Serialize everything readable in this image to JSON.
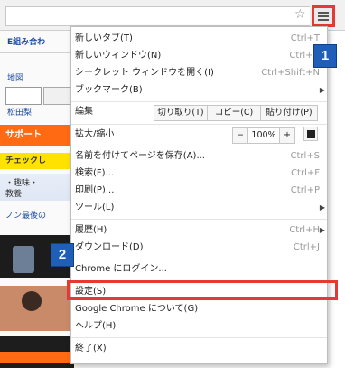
{
  "menu": {
    "items": [
      {
        "label": "新しいタブ(T)",
        "shortcut": "Ctrl+T"
      },
      {
        "label": "新しいウィンドウ(N)",
        "shortcut": "Ctrl+N"
      },
      {
        "label": "シークレット ウィンドウを開く(I)",
        "shortcut": "Ctrl+Shift+N"
      },
      {
        "label": "ブックマーク(B)"
      }
    ],
    "edit": {
      "label": "編集",
      "cut": "切り取り(T)",
      "copy": "コピー(C)",
      "paste": "貼り付け(P)"
    },
    "zoom": {
      "label": "拡大/縮小",
      "minus": "−",
      "value": "100%",
      "plus": "+"
    },
    "items2": [
      {
        "label": "名前を付けてページを保存(A)...",
        "shortcut": "Ctrl+S"
      },
      {
        "label": "検索(F)...",
        "shortcut": "Ctrl+F"
      },
      {
        "label": "印刷(P)...",
        "shortcut": "Ctrl+P"
      },
      {
        "label": "ツール(L)"
      }
    ],
    "history": {
      "label": "履歴(H)",
      "shortcut": "Ctrl+H"
    },
    "downloads": {
      "label": "ダウンロード(D)",
      "shortcut": "Ctrl+J"
    },
    "signin": {
      "label": "Chrome にログイン..."
    },
    "settings": {
      "label": "設定(S)"
    },
    "about": {
      "label": "Google Chrome について(G)"
    },
    "help": {
      "label": "ヘルプ(H)"
    },
    "exit": {
      "label": "終了(X)"
    }
  },
  "badges": {
    "step1": "1",
    "step2": "2"
  },
  "background_page": {
    "line1": "E組み合わ",
    "line2": "地図",
    "line3": "松田梨",
    "line4": "サポート",
    "line5": "チェックし",
    "line6": "・趣味・",
    "line7": "教養",
    "line8": "ノン最後の"
  },
  "colors": {
    "highlight": "#e53935",
    "badge": "#1f5fb8"
  }
}
